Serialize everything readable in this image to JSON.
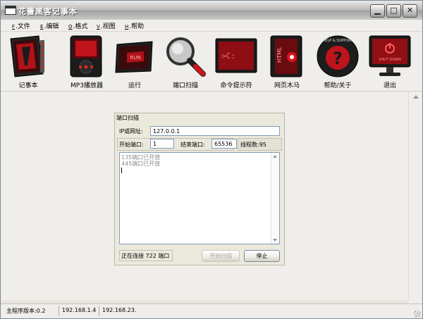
{
  "window": {
    "title": "花蕾黑客记事本",
    "buttons": {
      "minimize": "▁",
      "maximize": "□",
      "close": "✕"
    }
  },
  "menu": [
    {
      "key": "F",
      "label": "文件"
    },
    {
      "key": "E",
      "label": "编辑"
    },
    {
      "key": "O",
      "label": "格式"
    },
    {
      "key": "V",
      "label": "视图"
    },
    {
      "key": "H",
      "label": "帮助"
    }
  ],
  "toolbar": [
    {
      "label": "记事本",
      "icon": "notepad-icon"
    },
    {
      "label": "MP3播放器",
      "icon": "mp3-player-icon"
    },
    {
      "label": "运行",
      "icon": "run-icon"
    },
    {
      "label": "端口扫描",
      "icon": "magnifier-icon"
    },
    {
      "label": "命令提示符",
      "icon": "command-prompt-icon"
    },
    {
      "label": "网页木马",
      "icon": "html-icon"
    },
    {
      "label": "帮助/关于",
      "icon": "help-support-icon"
    },
    {
      "label": "退出",
      "icon": "shutdown-monitor-icon"
    }
  ],
  "icon_text": {
    "run": "RUN",
    "cmd": ">C:",
    "html": "HTML",
    "help": "HELP & SUPPORT",
    "shutdown": "SHUT DOWN"
  },
  "dialog": {
    "title": "端口扫描",
    "ip_label": "IP或网址:",
    "ip_value": "127.0.0.1",
    "start_port_label": "开始端口:",
    "start_port_value": "1",
    "end_port_label": "结束端口:",
    "end_port_value": "65536",
    "threads": "线程数:95",
    "log": [
      "135端口已开放",
      "445端口已开放"
    ],
    "status": "正在连接 722 端口",
    "start_scan_button": "开始扫描",
    "stop_button": "停止"
  },
  "statusbar": {
    "version": "主程序版本:0.2",
    "ip1": "192.168.1.4",
    "ip2": "192.168.23."
  },
  "colors": {
    "accent_red": "#d8121b",
    "icon_dark": "#1c1c1c"
  }
}
